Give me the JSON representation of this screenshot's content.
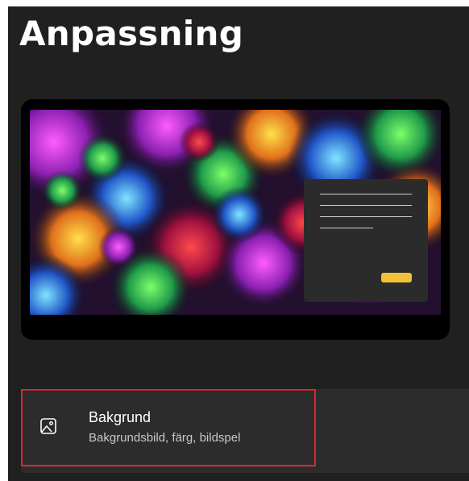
{
  "page": {
    "title": "Anpassning"
  },
  "preview": {
    "wallpaper": "psychedelic-fractal-wallpaper",
    "accent_color": "#f2c236",
    "dialog_text_lines": 4
  },
  "settings": {
    "items": [
      {
        "icon": "image-icon",
        "title": "Bakgrund",
        "subtitle": "Bakgrundsbild, färg, bildspel"
      }
    ]
  },
  "colors": {
    "window_bg": "#202020",
    "row_bg": "#2c2c2c",
    "highlight_border": "#e0252a"
  }
}
